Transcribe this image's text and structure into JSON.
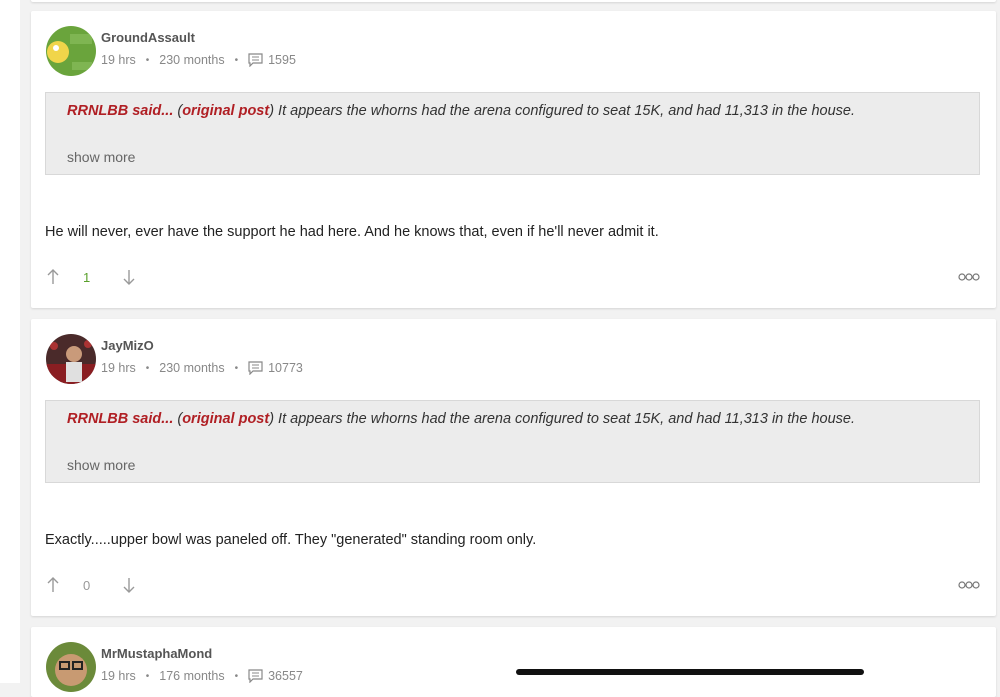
{
  "comments": [
    {
      "username": "GroundAssault",
      "time": "19 hrs",
      "tenure": "230 months",
      "post_count": "1595",
      "quote": {
        "author_said": "RRNLBB said...",
        "open_paren": " (",
        "link_text": "original post",
        "close_and_text": ") It appears the whorns had the arena configured to seat 15K, and had 11,313 in the house.",
        "show_more": "show more"
      },
      "body": "He will never, ever have the support he had here. And he knows that, even if he'll never admit it.",
      "votes": "1",
      "vote_color": "#5aa02c"
    },
    {
      "username": "JayMizO",
      "time": "19 hrs",
      "tenure": "230 months",
      "post_count": "10773",
      "quote": {
        "author_said": "RRNLBB said...",
        "open_paren": " (",
        "link_text": "original post",
        "close_and_text": ") It appears the whorns had the arena configured to seat 15K, and had 11,313 in the house.",
        "show_more": "show more"
      },
      "body": "Exactly.....upper bowl was paneled off. They \"generated\" standing room only.",
      "votes": "0",
      "vote_color": "#999999"
    },
    {
      "username": "MrMustaphaMond",
      "time": "19 hrs",
      "tenure": "176 months",
      "post_count": "36557"
    }
  ],
  "icons": {
    "upvote": "arrow-up-icon",
    "downvote": "arrow-down-icon",
    "comments": "comment-bubble-icon",
    "more": "more-options-icon"
  },
  "colors": {
    "quote_author": "#b01f24",
    "background": "#f2f2f2"
  }
}
